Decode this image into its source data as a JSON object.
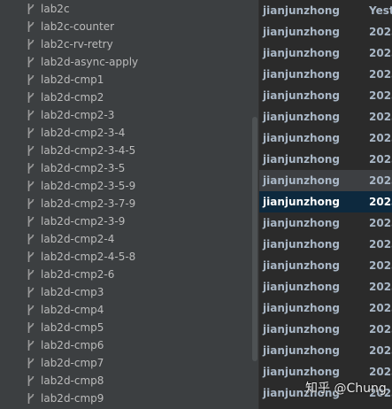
{
  "branches": [
    "lab2c",
    "lab2c-counter",
    "lab2c-rv-retry",
    "lab2d-async-apply",
    "lab2d-cmp1",
    "lab2d-cmp2",
    "lab2d-cmp2-3",
    "lab2d-cmp2-3-4",
    "lab2d-cmp2-3-4-5",
    "lab2d-cmp2-3-5",
    "lab2d-cmp2-3-5-9",
    "lab2d-cmp2-3-7-9",
    "lab2d-cmp2-3-9",
    "lab2d-cmp2-4",
    "lab2d-cmp2-4-5-8",
    "lab2d-cmp2-6",
    "lab2d-cmp3",
    "lab2d-cmp4",
    "lab2d-cmp5",
    "lab2d-cmp6",
    "lab2d-cmp7",
    "lab2d-cmp8",
    "lab2d-cmp9"
  ],
  "commits": [
    {
      "author": "jianjunzhong",
      "date": "Yesterday"
    },
    {
      "author": "jianjunzhong",
      "date": "2023"
    },
    {
      "author": "jianjunzhong",
      "date": "2023"
    },
    {
      "author": "jianjunzhong",
      "date": "2023"
    },
    {
      "author": "jianjunzhong",
      "date": "2023"
    },
    {
      "author": "jianjunzhong",
      "date": "2023"
    },
    {
      "author": "jianjunzhong",
      "date": "2023"
    },
    {
      "author": "jianjunzhong",
      "date": "2023"
    },
    {
      "author": "jianjunzhong",
      "date": "2023",
      "state": "sel-inactive"
    },
    {
      "author": "jianjunzhong",
      "date": "2023",
      "state": "sel-active"
    },
    {
      "author": "jianjunzhong",
      "date": "2023"
    },
    {
      "author": "jianjunzhong",
      "date": "2023"
    },
    {
      "author": "jianjunzhong",
      "date": "2023"
    },
    {
      "author": "jianjunzhong",
      "date": "2023"
    },
    {
      "author": "jianjunzhong",
      "date": "2023"
    },
    {
      "author": "jianjunzhong",
      "date": "2023"
    },
    {
      "author": "jianjunzhong",
      "date": "2023"
    },
    {
      "author": "jianjunzhong",
      "date": "2023"
    },
    {
      "author": "jianjunzhong",
      "date": "2023"
    }
  ],
  "watermark": "知乎 @Chung",
  "icon": "git-branch-icon"
}
